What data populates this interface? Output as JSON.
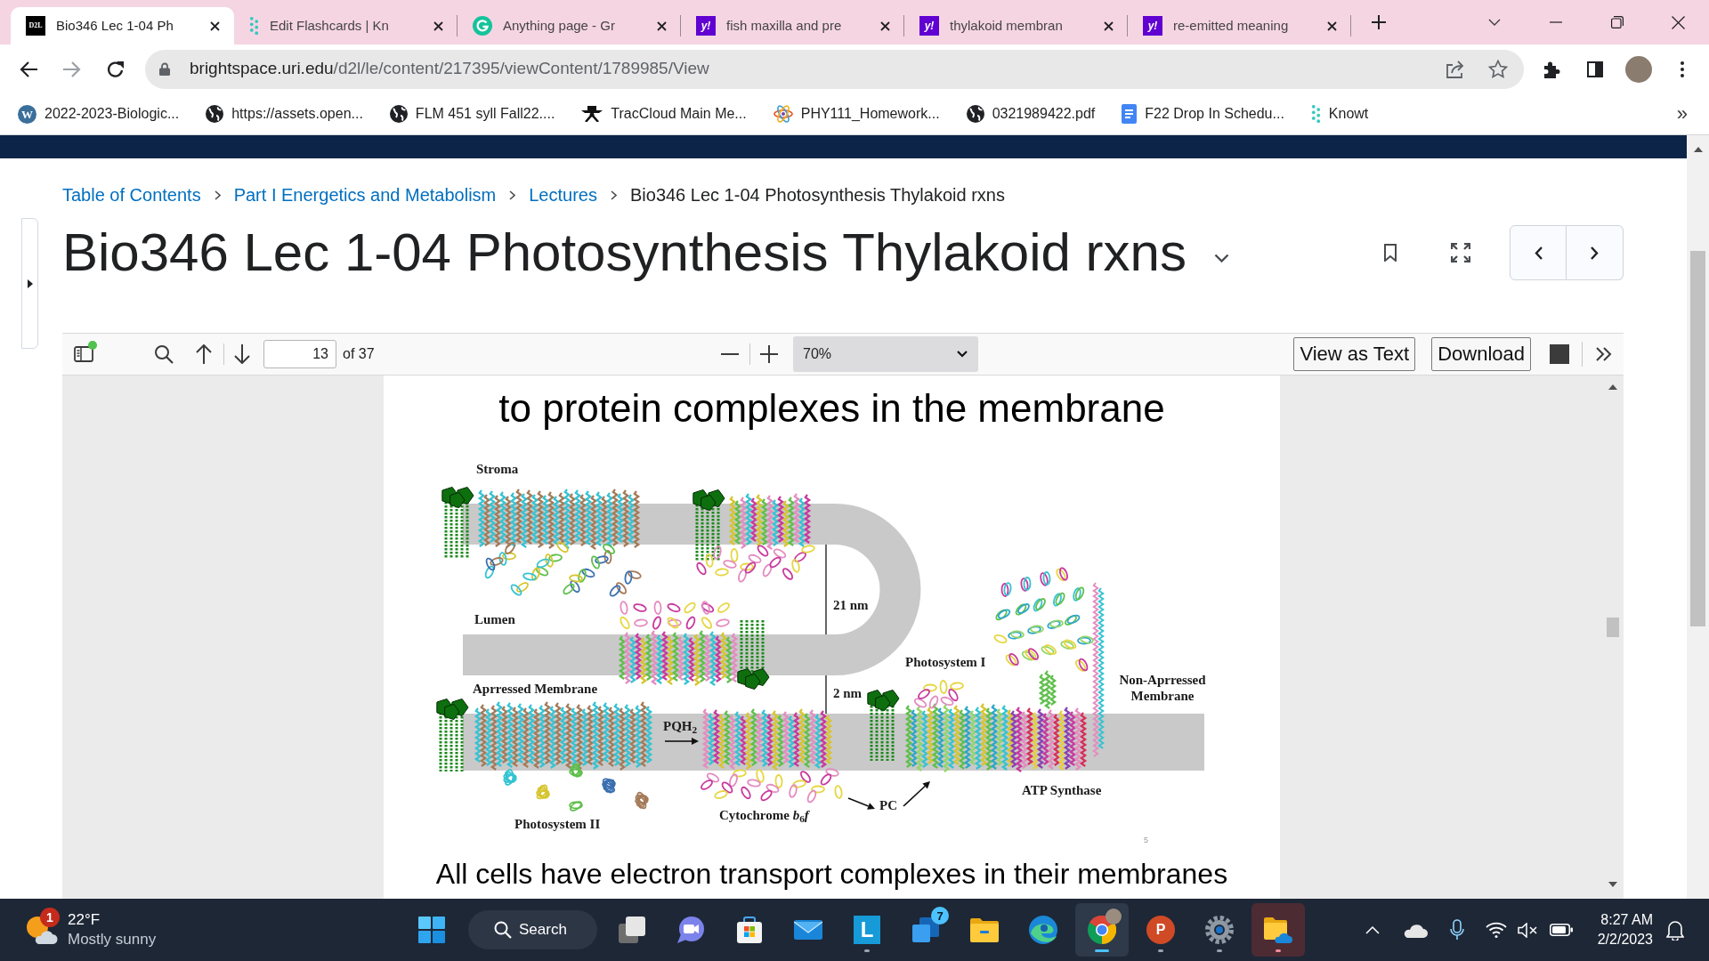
{
  "tabs": [
    {
      "kind": "d2l",
      "logo_text": "D2L",
      "title": "Bio346 Lec 1-04 Ph",
      "selected": true
    },
    {
      "kind": "knowt",
      "title": "Edit Flashcards | Kn",
      "selected": false
    },
    {
      "kind": "grammarly",
      "title": "Anything page - Gr",
      "selected": false
    },
    {
      "kind": "yahoo",
      "logo_text": "y!",
      "title": "fish maxilla and pre",
      "selected": false
    },
    {
      "kind": "yahoo",
      "logo_text": "y!",
      "title": "thylakoid membran",
      "selected": false
    },
    {
      "kind": "yahoo",
      "logo_text": "y!",
      "title": "re-emitted meaning",
      "selected": false
    }
  ],
  "address": {
    "host": "brightspace.uri.edu",
    "path": "/d2l/le/content/217395/viewContent/1789985/View"
  },
  "bookmarks": [
    {
      "kind": "wordpress",
      "logo_text": "W",
      "label": "2022-2023-Biologic..."
    },
    {
      "kind": "globe",
      "label": "https://assets.open..."
    },
    {
      "kind": "globe",
      "label": "FLM 451 syll Fall22...."
    },
    {
      "kind": "hat",
      "label": "TracCloud Main Me..."
    },
    {
      "kind": "atom",
      "label": "PHY111_Homework..."
    },
    {
      "kind": "globe",
      "label": "0321989422.pdf"
    },
    {
      "kind": "docs",
      "label": "F22 Drop In Schedu..."
    },
    {
      "kind": "knowt",
      "label": "Knowt"
    }
  ],
  "bookmarks_more": "»",
  "breadcrumbs": [
    {
      "label": "Table of Contents",
      "link": true
    },
    {
      "label": "Part I Energetics and Metabolism",
      "link": true
    },
    {
      "label": "Lectures",
      "link": true
    },
    {
      "label": "Bio346 Lec 1-04 Photosynthesis Thylakoid rxns",
      "link": false
    }
  ],
  "title": "Bio346 Lec 1-04 Photosynthesis Thylakoid rxns",
  "pdf_toolbar": {
    "page": "13",
    "page_count": "of 37",
    "zoom": "70%",
    "buttons": [
      "View as Text",
      "Download"
    ]
  },
  "slide": {
    "heading": "to protein complexes in the membrane",
    "figure_labels": [
      "Stroma",
      "21 nm",
      "Lumen",
      "Photosystem I",
      "Aprressed Membrane",
      "2 nm",
      "Non-Aprressed Membrane",
      "PQH$_{2}$",
      "ATP Synthase",
      "PC",
      "Cytochrome *b*$_{6}$*f*",
      "Photosystem II"
    ],
    "slide_number": "5",
    "caption": "All cells have electron transport complexes in their membranes"
  },
  "taskbar": {
    "weather": {
      "badge": "1",
      "temperature": "22°F",
      "condition": "Mostly sunny"
    },
    "search_label": "Search",
    "apps": [
      {
        "kind": "taskview",
        "open": false,
        "selected": false,
        "alert": false
      },
      {
        "kind": "chat",
        "open": false,
        "selected": false,
        "alert": false
      },
      {
        "kind": "store",
        "open": false,
        "selected": false,
        "alert": false
      },
      {
        "kind": "mail",
        "open": false,
        "selected": false,
        "alert": false
      },
      {
        "kind": "letter",
        "logo_text": "L",
        "open": true,
        "selected": false,
        "alert": false
      },
      {
        "kind": "stack",
        "badge": "7",
        "open": false,
        "selected": false,
        "alert": false
      },
      {
        "kind": "folder",
        "open": false,
        "selected": false,
        "alert": false
      },
      {
        "kind": "edge",
        "open": false,
        "selected": false,
        "alert": false
      },
      {
        "kind": "chrome",
        "open": true,
        "selected": true,
        "alert": false
      },
      {
        "kind": "slides",
        "logo_text": "P",
        "open": true,
        "selected": false,
        "alert": false
      },
      {
        "kind": "settings",
        "open": true,
        "selected": false,
        "alert": false
      },
      {
        "kind": "cloudfolder",
        "open": true,
        "selected": false,
        "alert": true
      }
    ],
    "clock": {
      "time": "8:27 AM",
      "date": "2/2/2023"
    }
  }
}
